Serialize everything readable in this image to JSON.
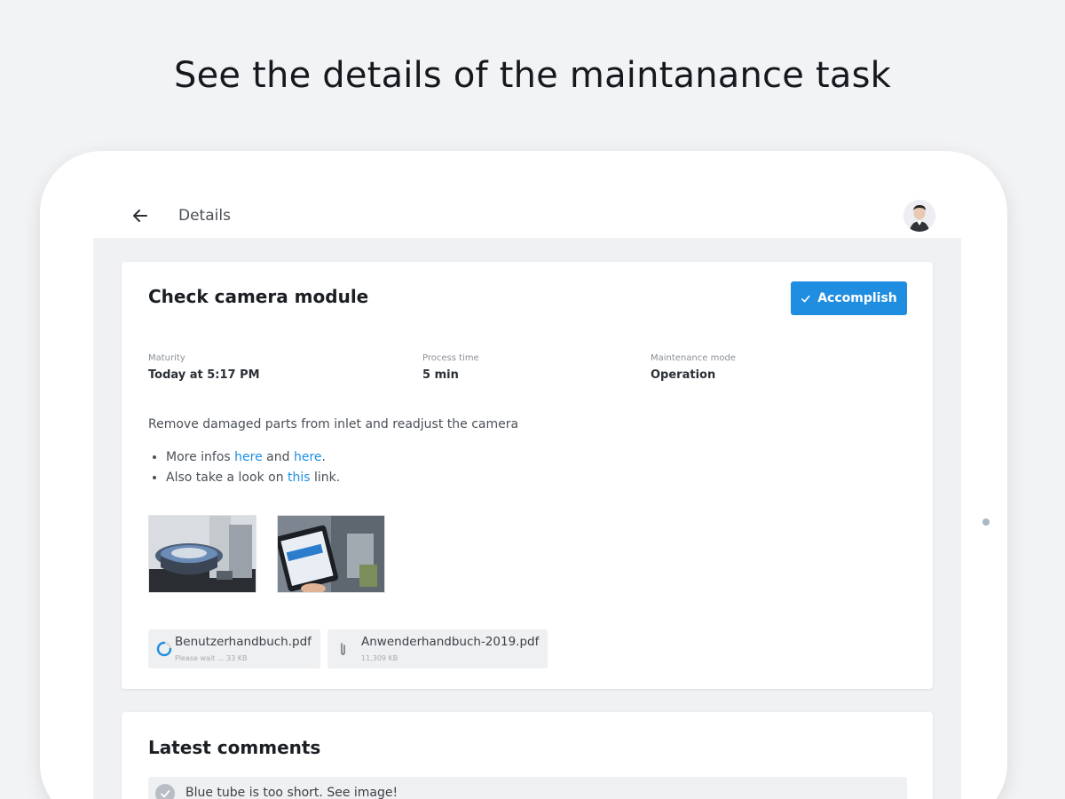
{
  "headline": "See the details of the maintanance task",
  "appbar": {
    "title": "Details"
  },
  "task": {
    "title": "Check camera module",
    "accomplish_label": "Accomplish",
    "meta": [
      {
        "label": "Maturity",
        "value": "Today at 5:17 PM"
      },
      {
        "label": "Process time",
        "value": "5 min"
      },
      {
        "label": "Maintenance mode",
        "value": "Operation"
      }
    ],
    "description": "Remove damaged parts from inlet and readjust the camera",
    "bullet1": {
      "prefix": "More infos ",
      "link1": "here",
      "mid": " and ",
      "link2": "here",
      "suffix": "."
    },
    "bullet2": {
      "prefix": "Also take a look on ",
      "link": "this",
      "suffix": " link."
    },
    "attachments": [
      {
        "name": "Benutzerhandbuch.pdf",
        "sub": "Please wait ... 33 KB",
        "icon": "loading-spinner-icon"
      },
      {
        "name": "Anwenderhandbuch-2019.pdf",
        "sub": "11,309 KB",
        "icon": "paperclip-icon"
      }
    ]
  },
  "comments": {
    "title": "Latest comments",
    "items": [
      {
        "text": "Blue tube is too short. See image!"
      }
    ]
  },
  "colors": {
    "accent": "#1f8ee0",
    "background": "#f2f3f5"
  }
}
